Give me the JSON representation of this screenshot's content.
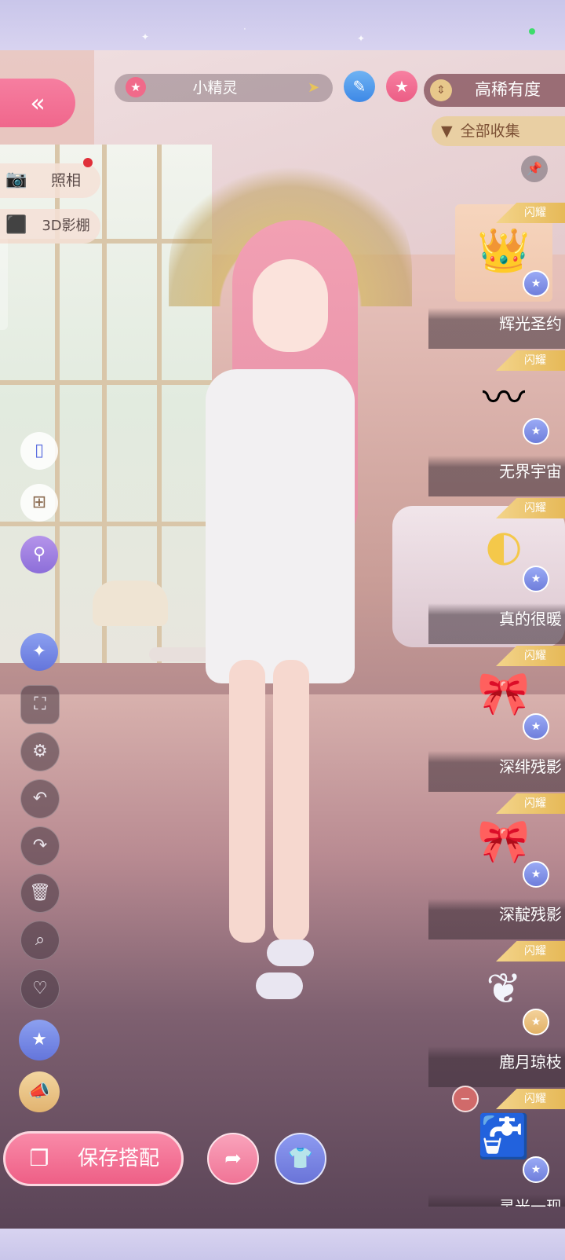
{
  "header": {
    "character_name": "小精灵",
    "sort_label": "高稀有度",
    "filter_label": "全部收集"
  },
  "left_panel": {
    "photo_label": "照相",
    "studio_label": "3D影棚"
  },
  "footer": {
    "save_label": "保存搭配"
  },
  "items": [
    {
      "name": "辉光圣约",
      "badge": "闪耀",
      "icon": "crown-icon",
      "tag": "star-tag",
      "selected": true
    },
    {
      "name": "无界宇宙",
      "badge": "闪耀",
      "icon": "hairpin-icon",
      "tag": "star-tag"
    },
    {
      "name": "真的很暖",
      "badge": "闪耀",
      "icon": "earmuff-icon",
      "tag": "star-tag"
    },
    {
      "name": "深绯残影",
      "badge": "闪耀",
      "icon": "ribbon-hair-icon",
      "tag": "star-tag"
    },
    {
      "name": "深靛残影",
      "badge": "闪耀",
      "icon": "ribbon-hair-icon",
      "tag": "star-tag"
    },
    {
      "name": "鹿月琼枝",
      "badge": "闪耀",
      "icon": "antler-icon",
      "tag": "gold-tag"
    },
    {
      "name": "灵光一现",
      "badge": "闪耀",
      "icon": "faucet-icon",
      "tag": "star-tag"
    }
  ],
  "colors": {
    "accent_pink": "#f0678c",
    "accent_blue": "#6475db",
    "badge_gold": "#e6b958"
  }
}
